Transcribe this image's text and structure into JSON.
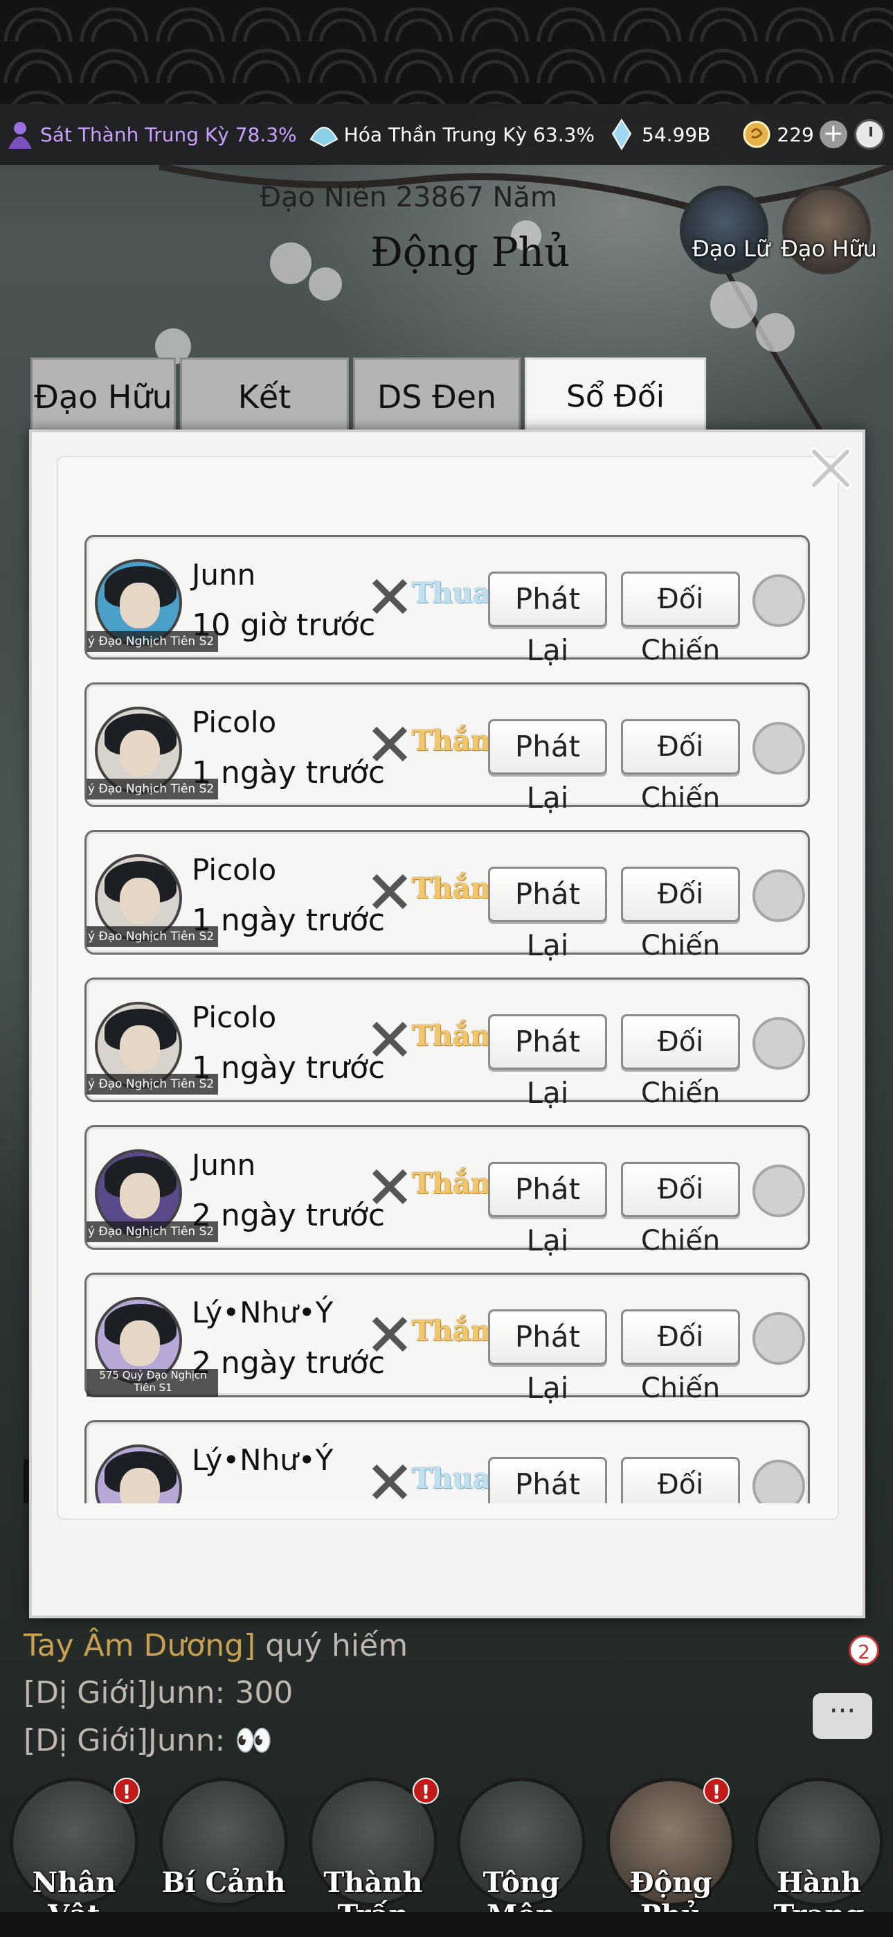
{
  "resources": {
    "cultivation_1": "Sát Thành Trung Kỳ 78.3%",
    "cultivation_2": "Hóa Thần Trung Kỳ 63.3%",
    "spirit_stones": "54.99B",
    "gold": "229"
  },
  "header": {
    "era": "Đạo Niên 23867 Năm",
    "title": "Động Phủ",
    "partner_label": "Đạo Lữ",
    "friend_label": "Đạo Hữu"
  },
  "tabs": [
    "Đạo Hữu",
    "Kết Duyên",
    "DS Đen",
    "Sổ Đối Chiến"
  ],
  "active_tab": "Sổ Đối Chiến",
  "battle_log": {
    "replay_label": "Phát Lại",
    "fight_label": "Đối Chiến",
    "entries": [
      {
        "name": "Junn",
        "time": "10 giờ trước",
        "result": "Thua",
        "server": "ý Đạo Nghịch Tiên S2"
      },
      {
        "name": "Picolo",
        "time": "1 ngày trước",
        "result": "Thắng",
        "server": "ý Đạo Nghịch Tiên S2"
      },
      {
        "name": "Picolo",
        "time": "1 ngày trước",
        "result": "Thắng",
        "server": "ý Đạo Nghịch Tiên S2"
      },
      {
        "name": "Picolo",
        "time": "1 ngày trước",
        "result": "Thắng",
        "server": "ý Đạo Nghịch Tiên S2"
      },
      {
        "name": "Junn",
        "time": "2 ngày trước",
        "result": "Thắng",
        "server": "ý Đạo Nghịch Tiên S2"
      },
      {
        "name": "Lý•Như•Ý",
        "time": "2 ngày trước",
        "result": "Thắng",
        "server": "575 Quỷ Đạo Nghịch Tiên S1"
      },
      {
        "name": "Lý•Như•Ý",
        "time": "",
        "result": "Thua",
        "server": ""
      }
    ]
  },
  "chat": {
    "line1_highlight": "Tay Âm Dương]",
    "line1_rest": " quý hiếm",
    "line2": "[Dị Giới]Junn:  300",
    "line3_prefix": "[Dị Giới]Junn:",
    "line3_emoji": "👀",
    "unread": "2",
    "more": "···"
  },
  "nav": [
    {
      "label": "Nhân Vật",
      "alert": true
    },
    {
      "label": "Bí Cảnh",
      "alert": false
    },
    {
      "label": "Thành Trấn",
      "alert": true
    },
    {
      "label": "Tông Môn",
      "alert": false
    },
    {
      "label": "Động Phủ",
      "alert": true
    },
    {
      "label": "Hành Trang",
      "alert": false
    }
  ],
  "colors": {
    "win": "#f2c76a",
    "lose": "#bfe0f0",
    "alert": "#c21a1a"
  }
}
